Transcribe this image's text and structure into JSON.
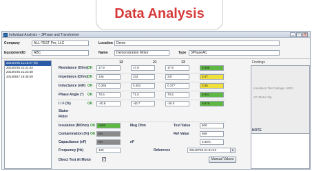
{
  "banner": {
    "title": "Data Analysis"
  },
  "window": {
    "title": "Individual Analysis -- 3Phase and Transformer",
    "min": "_",
    "max": "□",
    "close": "×"
  },
  "header": {
    "company_label": "Company",
    "company_value": "ALL-TEST Pro, LLC",
    "location_label": "Location",
    "location_value": "Demo",
    "equipment_label": "EquipmentID",
    "equipment_value": "ABC",
    "name_label": "Name",
    "name_value": "Demonstration Motor",
    "type_label": "Type",
    "type_value": "3PhaseAC"
  },
  "dates": [
    "20140725 11:19:27 (B)",
    "20140725 21:21:43",
    "20140725 21:23:48",
    "20140827 18:35:09"
  ],
  "columns": [
    "12",
    "21",
    "13"
  ],
  "measurements": [
    {
      "label": "Resistance (Ohm)",
      "ok": "OK",
      "v": [
        "17.9",
        "17.8",
        "17.9"
      ],
      "diff": "0.389",
      "color": "#5fb844"
    },
    {
      "label": "Impedance (Ohm)",
      "ok": "OK",
      "v": [
        "236",
        "232",
        "237"
      ],
      "diff": "3.47",
      "color": "#f2e03a"
    },
    {
      "label": "Inductance (mH)",
      "ok": "OK",
      "v": [
        "0.365",
        "0.352",
        "0.377"
      ],
      "diff": "3.55",
      "color": "#f2e03a"
    },
    {
      "label": "Phase Angle (°)",
      "ok": "OK",
      "v": [
        "70.6",
        "71.5",
        "70.5"
      ],
      "diff": "0.951",
      "color": "#5fb844"
    },
    {
      "label": "I / F (%)",
      "ok": "OK",
      "v": [
        "-40.8",
        "-40.7",
        "-40.0"
      ],
      "diff": "0.978",
      "color": "#5fb844"
    }
  ],
  "sections": {
    "stator": "Stator",
    "rotor": "Rotor"
  },
  "insulation": {
    "label": "Insulation (MOhm)",
    "ok": "OK",
    "value": ">500",
    "color": "#5fb844",
    "mid_label": "Meg Ohm",
    "right_label": "Test Value",
    "right_value": "600"
  },
  "contamination": {
    "label": "Contamination (%)",
    "ok": "OK",
    "value": "NA",
    "color": "#8a8a8a",
    "right_label": "Ref Value",
    "right_value": "669"
  },
  "capacitance": {
    "label": "Capacitance (nF)",
    "value": "NA",
    "color": "#8a8a8a",
    "mid_label": "nF",
    "right_value": "0.00%"
  },
  "frequency": {
    "label": "Frequency (Hz)",
    "value": "100",
    "ref_label": "Reference",
    "ref_value": "20140725-21:21:43"
  },
  "direct_test": {
    "label": "Direct Test At Motor",
    "checked": "✓"
  },
  "manual_button": "Manual Values",
  "findings": {
    "title": "Findings",
    "items": [
      "Insulation Test Voltage: 500V",
      "AC Motor 2/p"
    ]
  },
  "note": {
    "title": "NOTE"
  }
}
